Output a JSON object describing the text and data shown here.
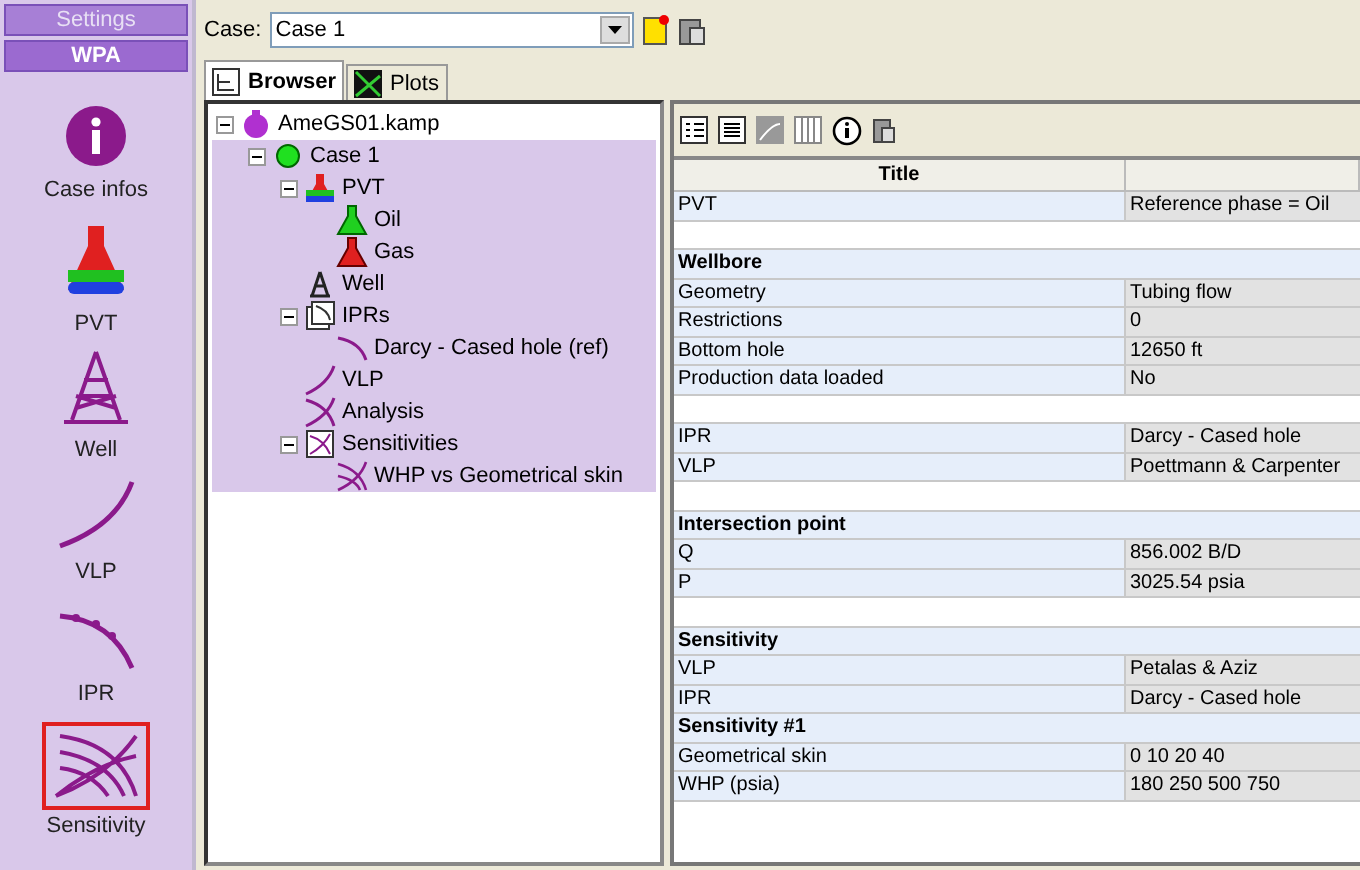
{
  "sidebar": {
    "header_buttons": [
      {
        "label": "Settings",
        "selected": false
      },
      {
        "label": "WPA",
        "selected": true
      }
    ],
    "items": [
      {
        "label": "Case infos",
        "kind": "info",
        "selected": false
      },
      {
        "label": "PVT",
        "kind": "pvt",
        "selected": false
      },
      {
        "label": "Well",
        "kind": "well",
        "selected": false
      },
      {
        "label": "VLP",
        "kind": "vlp",
        "selected": false
      },
      {
        "label": "IPR",
        "kind": "ipr",
        "selected": false
      },
      {
        "label": "Sensitivity",
        "kind": "sensitivity",
        "selected": true
      }
    ]
  },
  "toolbar": {
    "case_label": "Case:",
    "case_value": "Case 1"
  },
  "tabs": [
    {
      "label": "Browser",
      "kind": "browser",
      "selected": true
    },
    {
      "label": "Plots",
      "kind": "plots",
      "selected": false
    }
  ],
  "tree": [
    {
      "label": "AmeGS01.kamp",
      "kind": "file",
      "selected": false,
      "expanded": true,
      "children": [
        {
          "label": "Case 1",
          "kind": "case",
          "selected": true,
          "expanded": true,
          "children": [
            {
              "label": "PVT",
              "kind": "pvt",
              "selected": true,
              "expanded": true,
              "children": [
                {
                  "label": "Oil",
                  "kind": "oil",
                  "selected": true
                },
                {
                  "label": "Gas",
                  "kind": "gas",
                  "selected": true
                }
              ]
            },
            {
              "label": "Well",
              "kind": "well",
              "selected": true
            },
            {
              "label": "IPRs",
              "kind": "iprs",
              "selected": true,
              "expanded": true,
              "children": [
                {
                  "label": "Darcy - Cased hole (ref)",
                  "kind": "ipr",
                  "selected": true
                }
              ]
            },
            {
              "label": "VLP",
              "kind": "vlp",
              "selected": true
            },
            {
              "label": "Analysis",
              "kind": "analysis",
              "selected": true
            },
            {
              "label": "Sensitivities",
              "kind": "sens",
              "selected": true,
              "expanded": true,
              "children": [
                {
                  "label": "WHP vs Geometrical skin",
                  "kind": "sensitem",
                  "selected": true
                }
              ]
            }
          ]
        }
      ]
    }
  ],
  "table": {
    "columns": [
      "Title"
    ],
    "rows": [
      {
        "kind": "pair",
        "label": "PVT",
        "value": "Reference phase = Oil"
      },
      {
        "kind": "blank"
      },
      {
        "kind": "section",
        "label": "Wellbore"
      },
      {
        "kind": "pair",
        "label": "Geometry",
        "value": "Tubing flow"
      },
      {
        "kind": "pair",
        "label": "Restrictions",
        "value": "0"
      },
      {
        "kind": "pair",
        "label": "Bottom hole",
        "value": "12650 ft"
      },
      {
        "kind": "pair",
        "label": "Production data loaded",
        "value": "No"
      },
      {
        "kind": "blank"
      },
      {
        "kind": "pair",
        "label": "IPR",
        "value": "Darcy - Cased hole"
      },
      {
        "kind": "pair",
        "label": "VLP",
        "value": "Poettmann & Carpenter"
      },
      {
        "kind": "blank"
      },
      {
        "kind": "section",
        "label": "Intersection point"
      },
      {
        "kind": "pair",
        "label": "Q",
        "value": "856.002 B/D"
      },
      {
        "kind": "pair",
        "label": "P",
        "value": "3025.54 psia"
      },
      {
        "kind": "blank"
      },
      {
        "kind": "section",
        "label": "Sensitivity"
      },
      {
        "kind": "pair",
        "label": "VLP",
        "value": "Petalas & Aziz"
      },
      {
        "kind": "pair",
        "label": "IPR",
        "value": "Darcy - Cased hole"
      },
      {
        "kind": "section",
        "label": "Sensitivity #1"
      },
      {
        "kind": "pair",
        "label": "Geometrical skin",
        "value": "0 10 20 40"
      },
      {
        "kind": "pair",
        "label": "WHP (psia)",
        "value": "180 250 500 750"
      }
    ]
  }
}
